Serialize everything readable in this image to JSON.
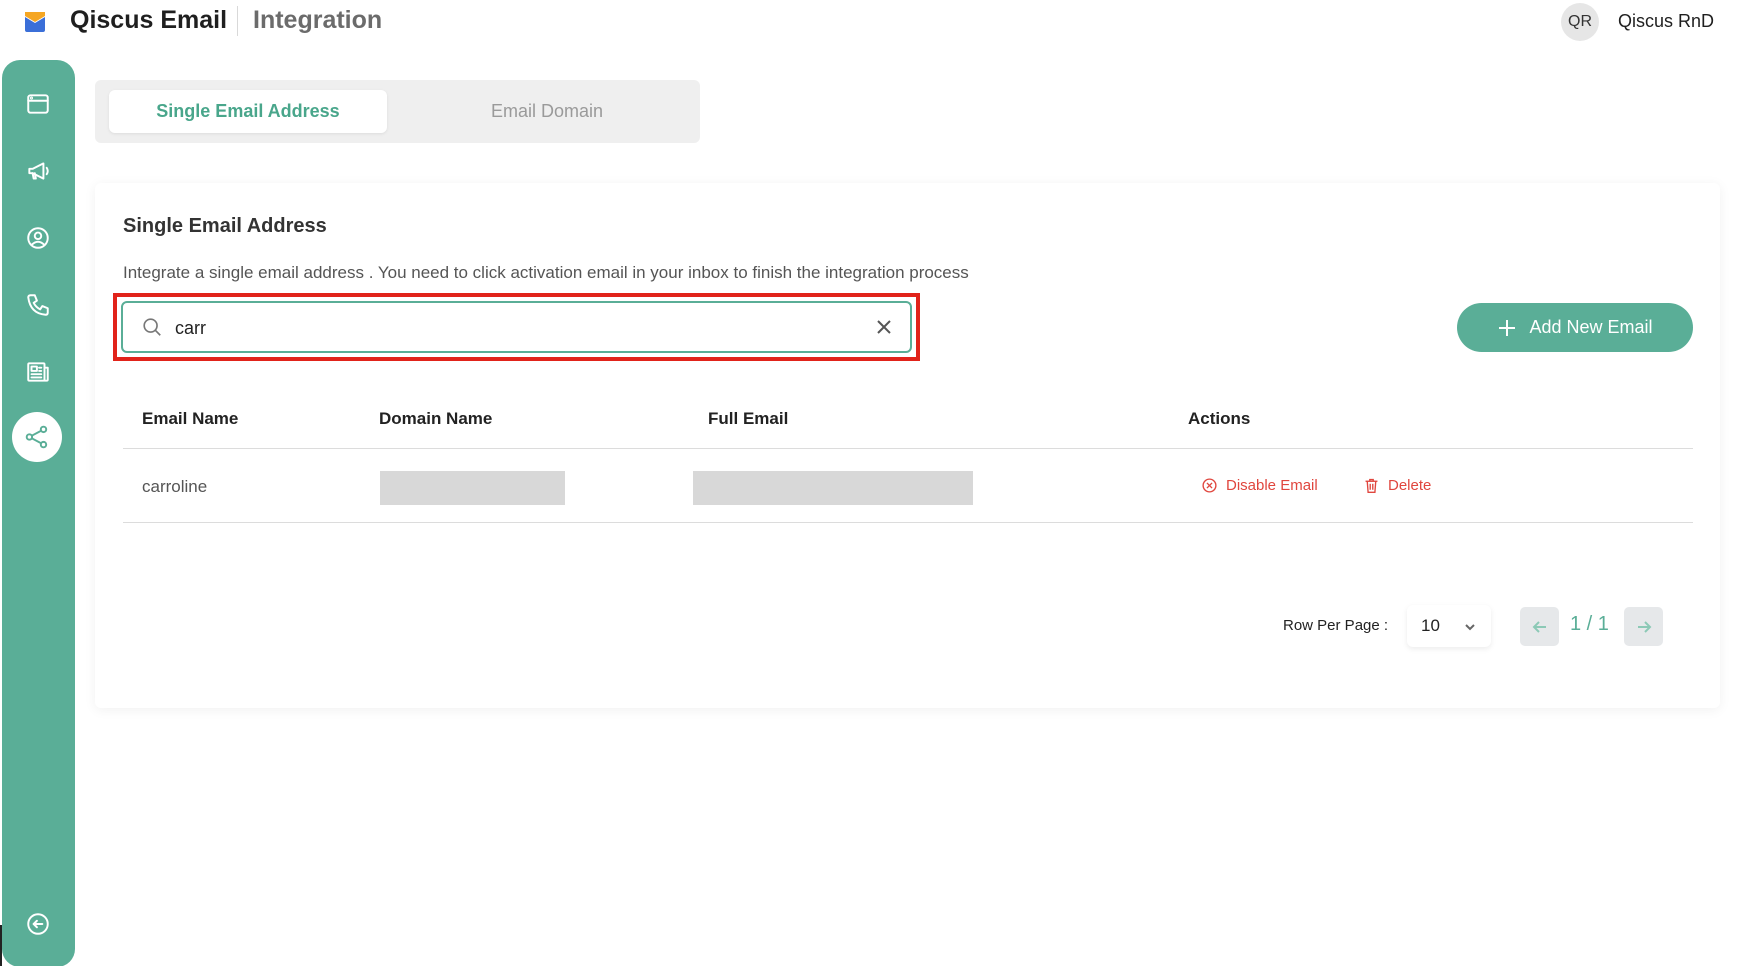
{
  "header": {
    "app_name": "Qiscus Email",
    "page_name": "Integration",
    "user_initials": "QR",
    "user_name": "Qiscus RnD"
  },
  "sidebar": {
    "items": [
      {
        "icon": "browser-window-icon",
        "active": false
      },
      {
        "icon": "megaphone-icon",
        "active": false
      },
      {
        "icon": "user-circle-icon",
        "active": false
      },
      {
        "icon": "phone-icon",
        "active": false
      },
      {
        "icon": "newspaper-icon",
        "active": false
      },
      {
        "icon": "share-nodes-icon",
        "active": true
      }
    ],
    "collapse_icon": "collapse-arrow-icon"
  },
  "tabs": [
    {
      "label": "Single Email Address",
      "active": true
    },
    {
      "label": "Email Domain",
      "active": false
    }
  ],
  "card": {
    "title": "Single Email Address",
    "description": "Integrate a single email address . You need to click activation email in your inbox to finish the integration process"
  },
  "search": {
    "value": "carr",
    "placeholder": ""
  },
  "add_button": {
    "label": "Add New Email"
  },
  "table": {
    "columns": [
      "Email Name",
      "Domain Name",
      "Full Email",
      "Actions"
    ],
    "rows": [
      {
        "email_name": "carroline",
        "domain_name": "",
        "full_email": ""
      }
    ],
    "actions": {
      "disable": "Disable Email",
      "delete": "Delete"
    }
  },
  "pagination": {
    "rows_per_page_label": "Row Per Page :",
    "rows_per_page": "10",
    "page_indicator": "1 / 1"
  },
  "colors": {
    "accent": "#5aae97",
    "danger": "#e0463e",
    "highlight": "#e1231a"
  }
}
